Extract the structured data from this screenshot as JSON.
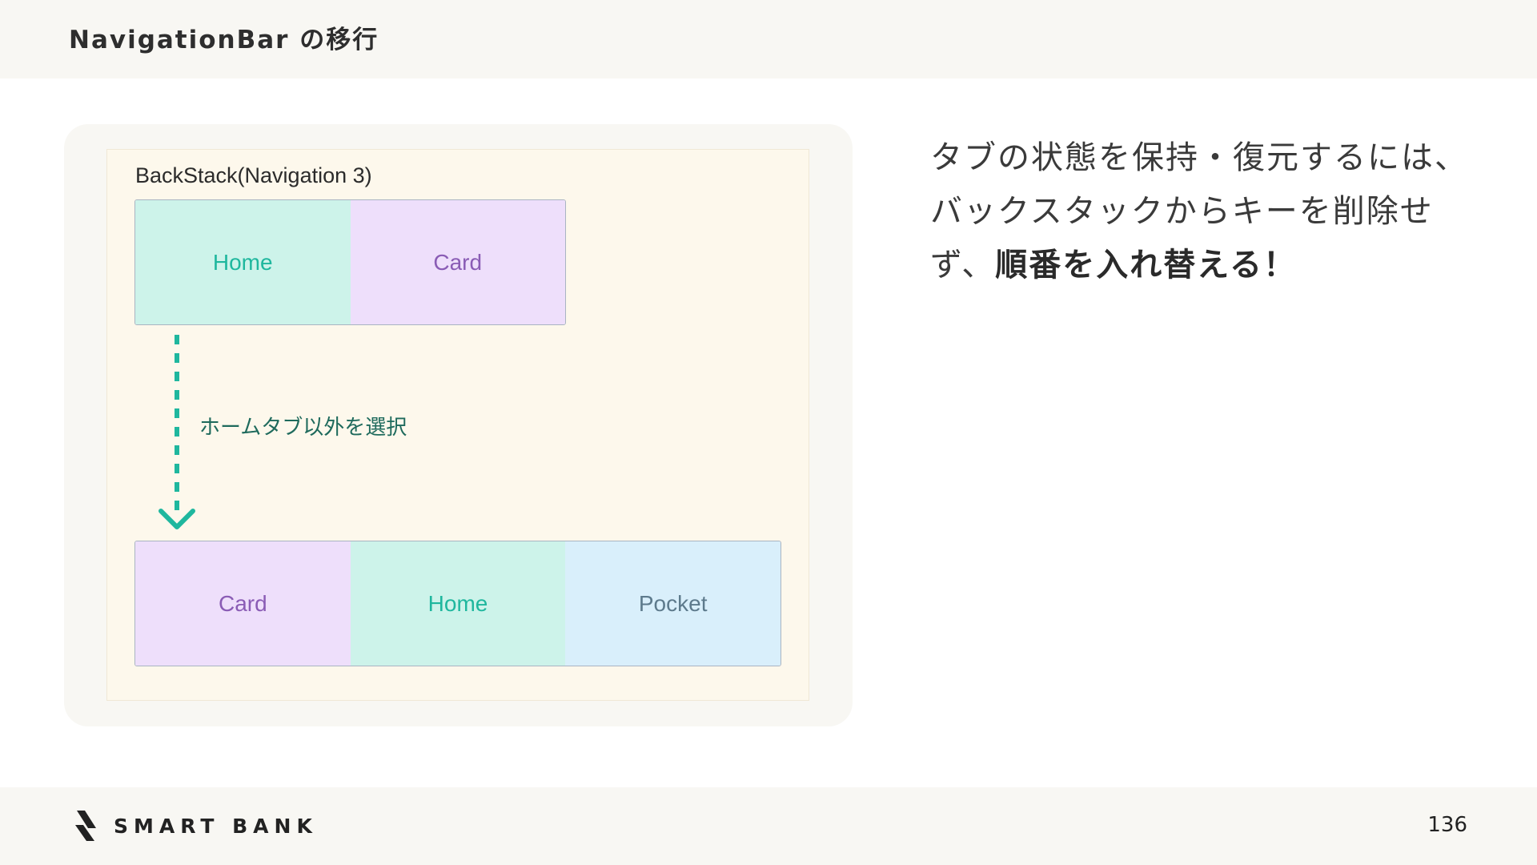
{
  "header": {
    "title": "NavigationBar の移行"
  },
  "diagram": {
    "stack_label": "BackStack(Navigation 3)",
    "top_stack": [
      {
        "label": "Home",
        "kind": "home"
      },
      {
        "label": "Card",
        "kind": "card"
      }
    ],
    "transition_label": "ホームタブ以外を選択",
    "bottom_stack": [
      {
        "label": "Card",
        "kind": "card"
      },
      {
        "label": "Home",
        "kind": "home"
      },
      {
        "label": "Pocket",
        "kind": "pocket"
      }
    ],
    "colors": {
      "home_bg": "#cdf3ea",
      "home_text": "#1fb79e",
      "card_bg": "#eedffb",
      "card_text": "#8a5cb5",
      "pocket_bg": "#d9effb",
      "pocket_text": "#5d7a8c",
      "arrow": "#1fb79e"
    }
  },
  "body": {
    "text_plain": "タブの状態を保持・復元するには、バックスタックからキーを削除せず、",
    "text_strong": "順番を入れ替える！"
  },
  "footer": {
    "logo_text": "SMART BANK",
    "logo_icon": "smartbank-logo-icon",
    "page_number": "136"
  }
}
